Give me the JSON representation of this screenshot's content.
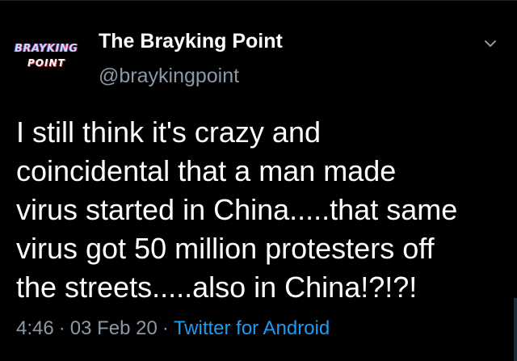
{
  "user": {
    "avatar_text_line1": "BRAYKING",
    "avatar_text_line2": "POINT",
    "display_name": "The Brayking Point",
    "handle": "@braykingpoint"
  },
  "tweet": {
    "lines": [
      "I still think it's crazy and",
      "coincidental that a man made",
      "virus started in China.....that same",
      "virus got 50 million protesters off",
      "the streets.....also in China!?!?!"
    ],
    "time": "4:46",
    "date": "03 Feb 20",
    "separator": "·",
    "source": "Twitter for Android"
  },
  "icons": {
    "menu": "chevron-down-icon"
  },
  "colors": {
    "background": "#000000",
    "primary_text": "#ffffff",
    "secondary_text": "#8b98a5",
    "link": "#1d9bf0"
  }
}
